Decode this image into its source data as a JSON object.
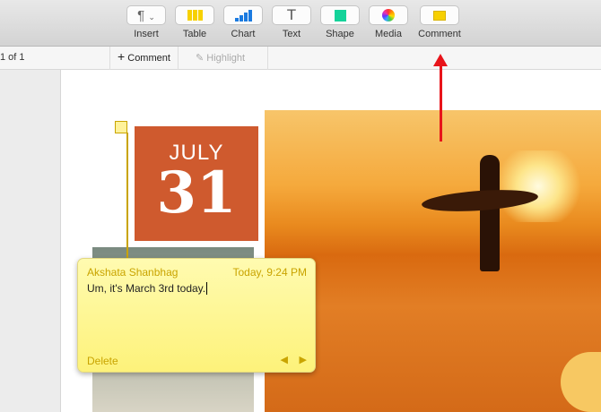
{
  "toolbar": {
    "items": [
      {
        "label": "Insert",
        "icon": "paragraph-icon"
      },
      {
        "label": "Table",
        "icon": "table-icon"
      },
      {
        "label": "Chart",
        "icon": "chart-icon"
      },
      {
        "label": "Text",
        "icon": "text-icon"
      },
      {
        "label": "Shape",
        "icon": "shape-icon"
      },
      {
        "label": "Media",
        "icon": "media-icon"
      },
      {
        "label": "Comment",
        "icon": "comment-icon"
      }
    ]
  },
  "format_bar": {
    "page_count": "1 of 1",
    "comment_label": "Comment",
    "highlight_label": "Highlight"
  },
  "calendar": {
    "month": "JULY",
    "day": "31"
  },
  "comment": {
    "author": "Akshata Shanbhag",
    "time": "Today, 9:24 PM",
    "text": "Um, it's March 3rd today.",
    "delete_label": "Delete"
  },
  "colors": {
    "accent": "#c9a400",
    "arrow": "#e8141a"
  }
}
